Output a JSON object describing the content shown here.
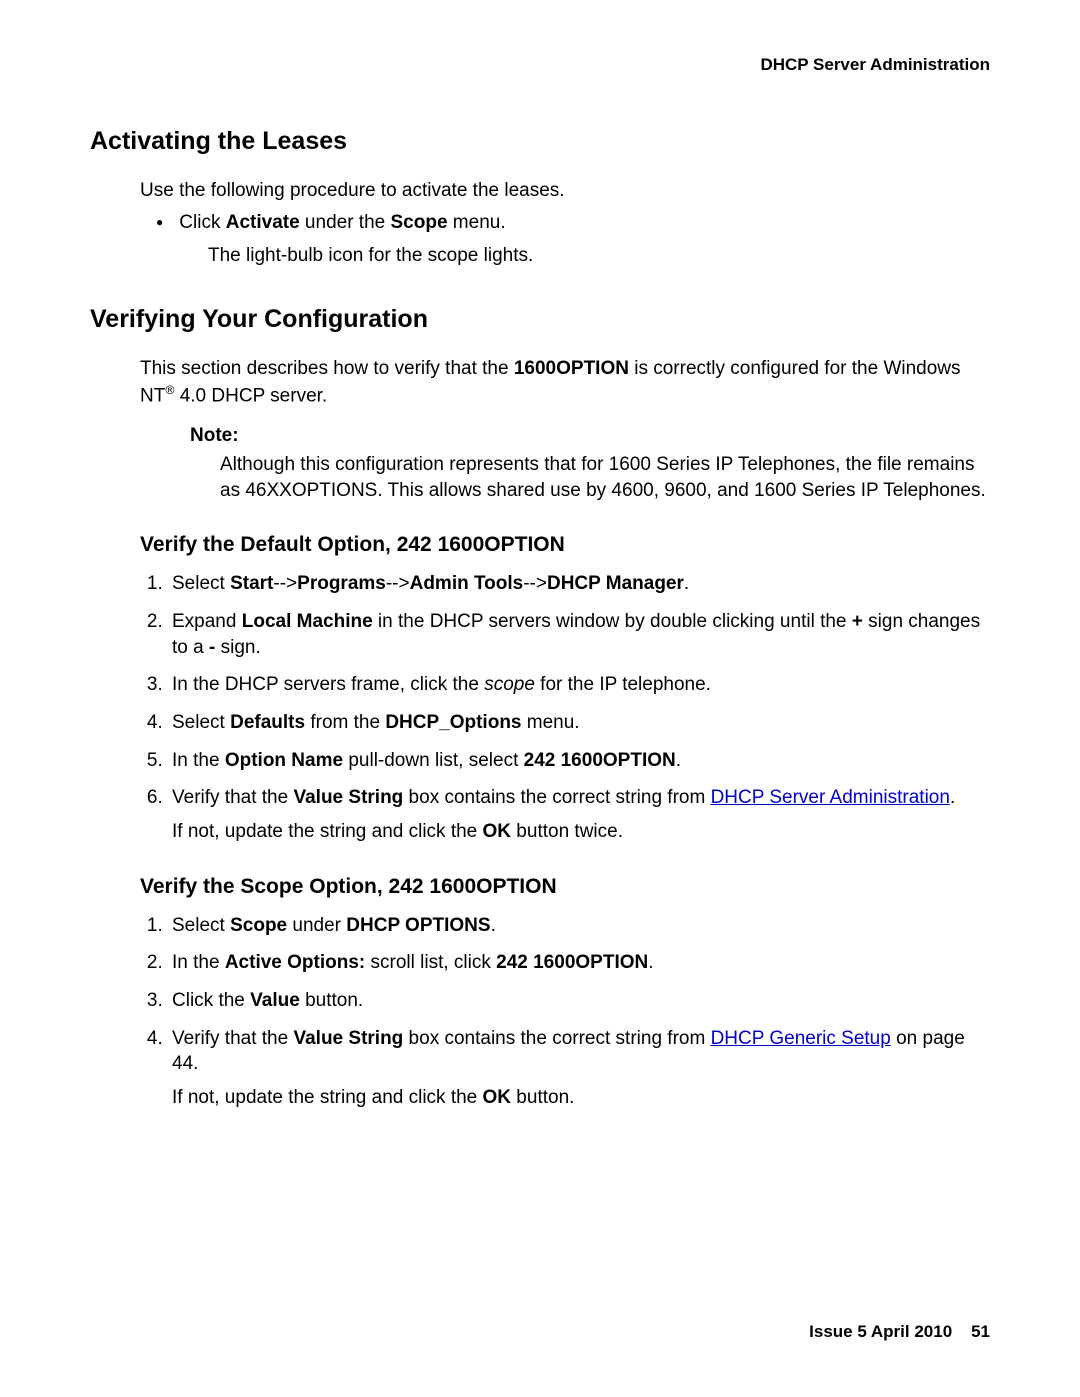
{
  "running_header": "DHCP Server Administration",
  "s1": {
    "heading": "Activating the Leases",
    "intro": "Use the following procedure to activate the leases.",
    "bullet_prefix": "Click ",
    "bullet_bold1": "Activate",
    "bullet_mid": " under the ",
    "bullet_bold2": "Scope",
    "bullet_suffix": " menu.",
    "sub": "The light-bulb icon for the scope lights."
  },
  "s2": {
    "heading": "Verifying Your Configuration",
    "intro_a": "This section describes how to verify that the ",
    "intro_bold": "1600OPTION",
    "intro_b": " is correctly configured for the Windows NT",
    "intro_reg": "®",
    "intro_c": " 4.0 DHCP server.",
    "note_label": "Note:",
    "note_body": "Although this configuration represents that for 1600 Series IP Telephones, the file remains as 46XXOPTIONS. This allows shared use by 4600, 9600, and 1600 Series IP Telephones."
  },
  "sd": {
    "heading": "Verify the Default Option, 242 1600OPTION",
    "st1_a": "Select ",
    "st1_b1": "Start",
    "st1_arr1": "-->",
    "st1_b2": "Programs",
    "st1_arr2": "-->",
    "st1_b3": "Admin Tools",
    "st1_arr3": "-->",
    "st1_b4": "DHCP Manager",
    "st1_end": ".",
    "st2_a": "Expand ",
    "st2_b1": "Local Machine",
    "st2_b": " in the DHCP servers window by double clicking until the ",
    "st2_b2": "+",
    "st2_c": " sign changes to a ",
    "st2_b3": "-",
    "st2_d": " sign.",
    "st3_a": "In the DHCP servers frame, click the ",
    "st3_i": "scope",
    "st3_b": " for the IP telephone.",
    "st4_a": "Select ",
    "st4_b1": "Defaults",
    "st4_b": " from the ",
    "st4_b2": "DHCP_Options",
    "st4_c": " menu.",
    "st5_a": "In the ",
    "st5_b1": "Option Name",
    "st5_b": " pull-down list, select ",
    "st5_b2": "242 1600OPTION",
    "st5_c": ".",
    "st6_a": "Verify that the ",
    "st6_b1": "Value String",
    "st6_b": " box contains the correct string from ",
    "st6_link": "DHCP Server Administration",
    "st6_c": ".",
    "st6_extra_a": "If not, update the string and click the ",
    "st6_extra_b": "OK",
    "st6_extra_c": " button twice."
  },
  "ss": {
    "heading": "Verify the Scope Option, 242 1600OPTION",
    "st1_a": "Select ",
    "st1_b1": "Scope",
    "st1_b": " under ",
    "st1_b2": "DHCP OPTIONS",
    "st1_c": ".",
    "st2_a": "In the ",
    "st2_b1": "Active Options:",
    "st2_b": " scroll list, click ",
    "st2_b2": "242 1600OPTION",
    "st2_c": ".",
    "st3_a": "Click the ",
    "st3_b1": "Value",
    "st3_b": " button.",
    "st4_a": "Verify that the ",
    "st4_b1": "Value String",
    "st4_b": " box contains the correct string from ",
    "st4_link": "DHCP Generic Setup",
    "st4_c": " on page 44.",
    "st4_extra_a": "If not, update the string and click the ",
    "st4_extra_b": "OK",
    "st4_extra_c": " button."
  },
  "footer": {
    "issue": "Issue 5   April 2010",
    "page": "51"
  }
}
